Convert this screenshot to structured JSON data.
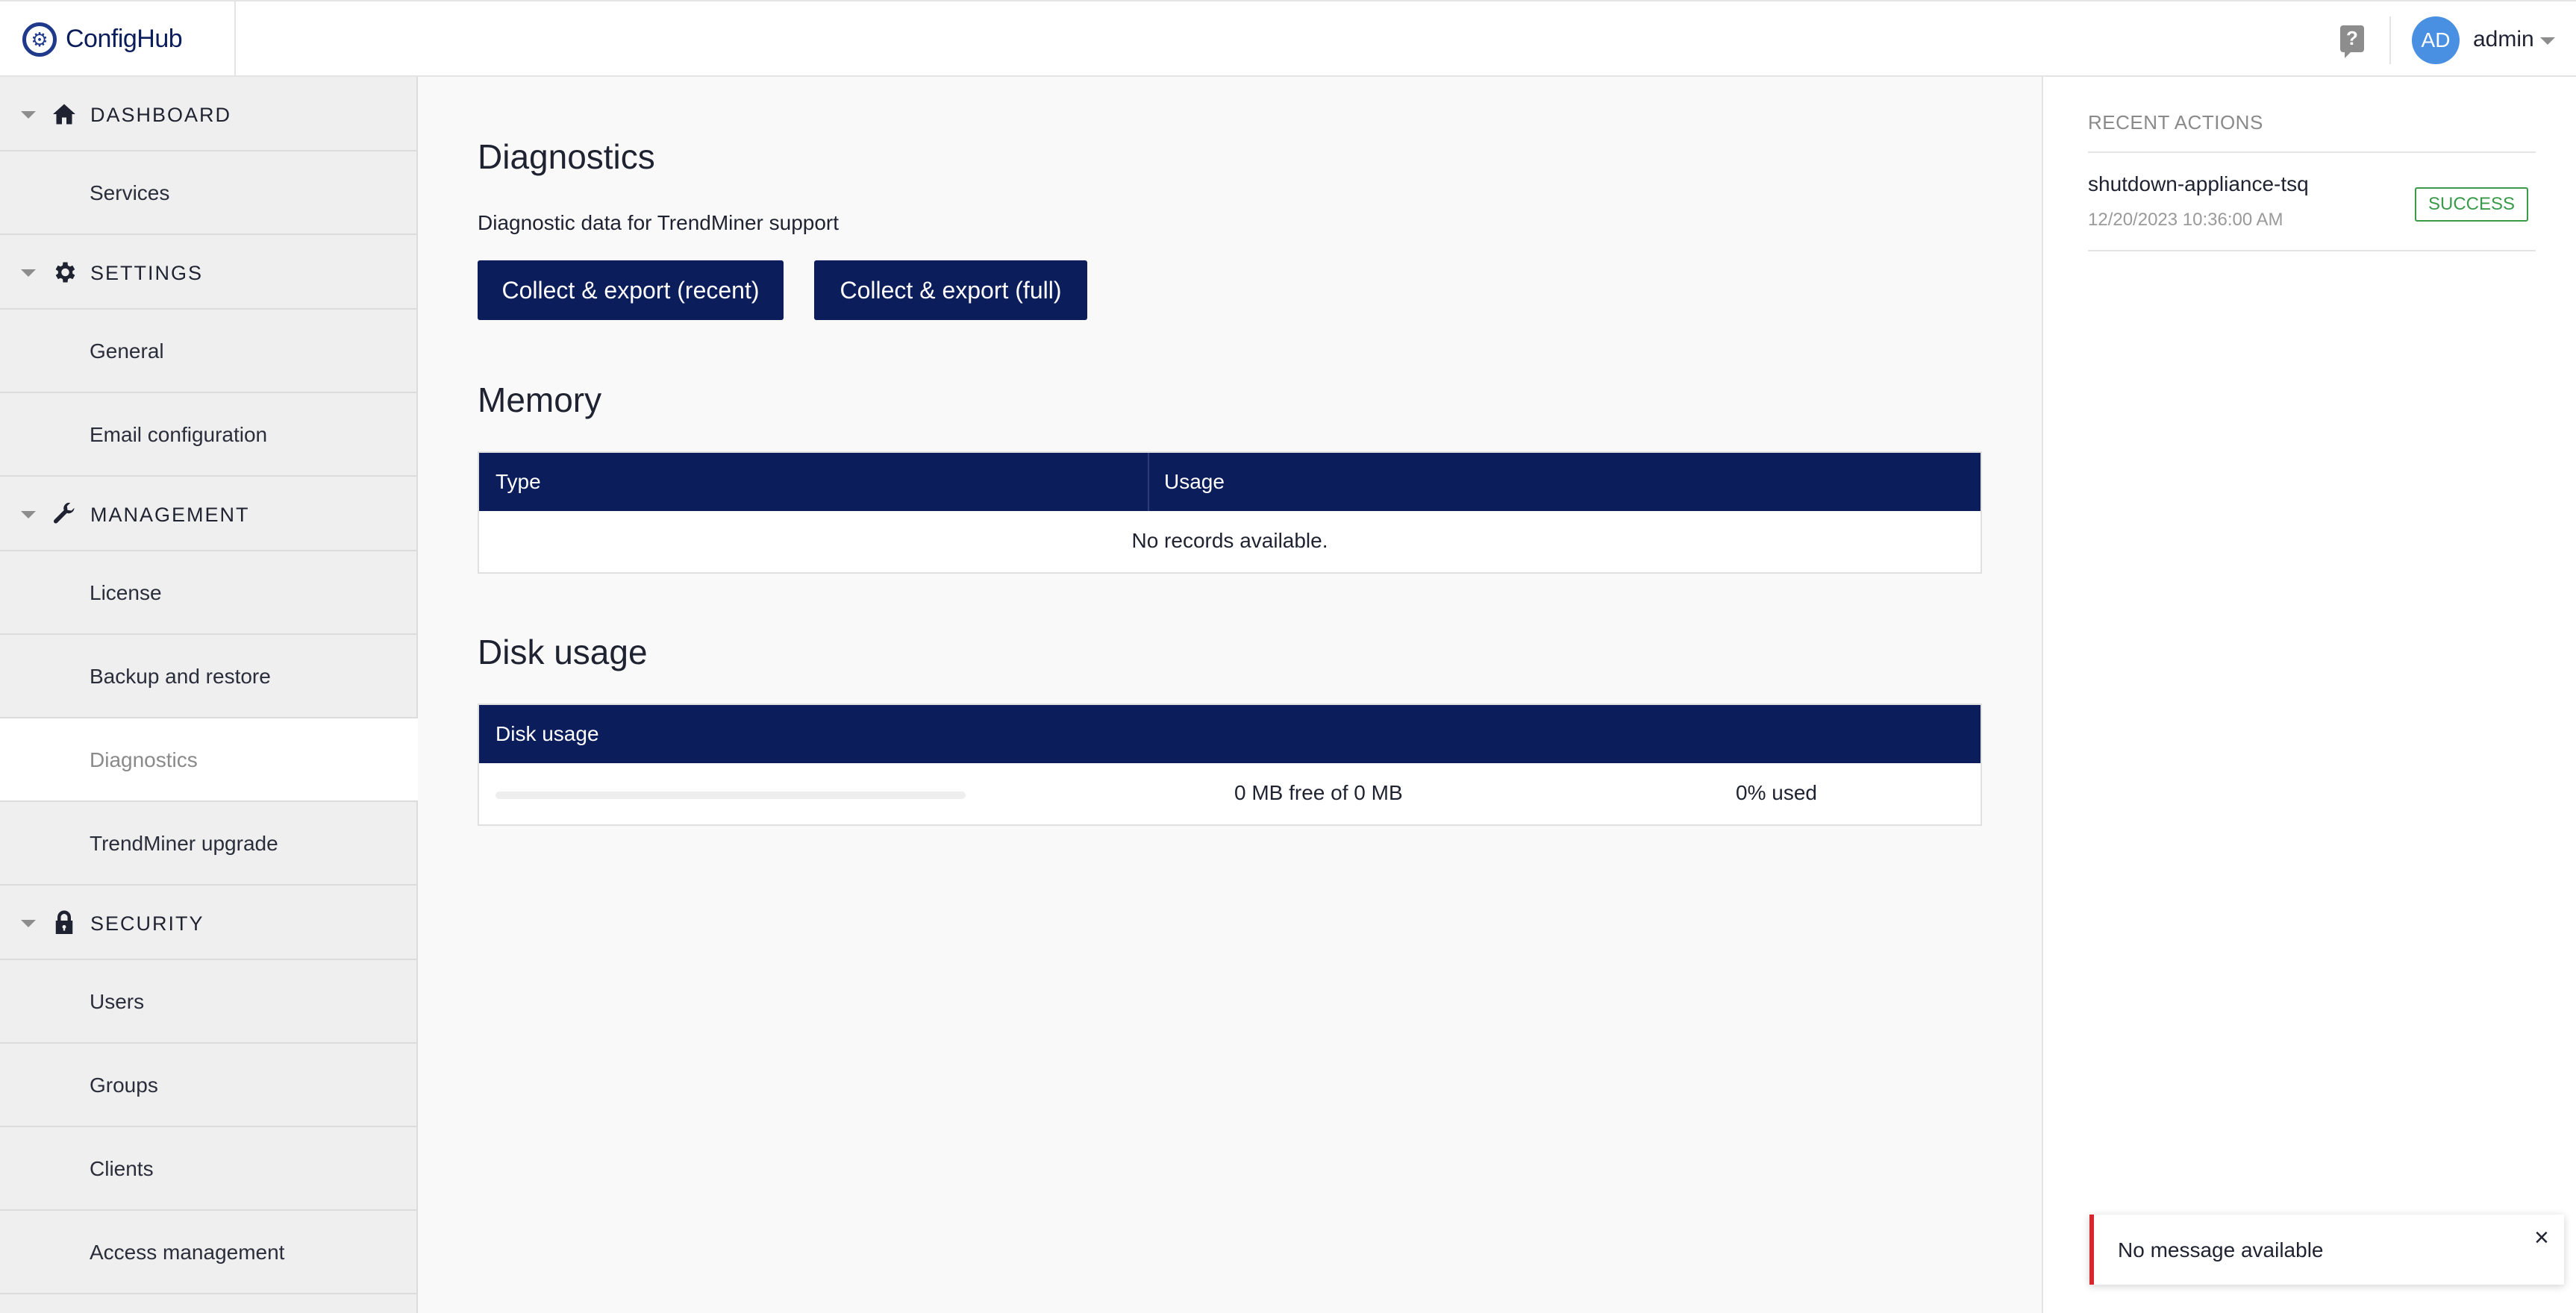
{
  "header": {
    "app_name": "ConfigHub",
    "help_icon": "question-mark-icon",
    "user_initials": "AD",
    "user_name": "admin"
  },
  "sidebar": {
    "sections": [
      {
        "label": "DASHBOARD",
        "icon": "home-icon",
        "items": [
          "Services"
        ]
      },
      {
        "label": "SETTINGS",
        "icon": "gear-icon",
        "items": [
          "General",
          "Email configuration"
        ]
      },
      {
        "label": "MANAGEMENT",
        "icon": "wrench-icon",
        "items": [
          "License",
          "Backup and restore",
          "Diagnostics",
          "TrendMiner upgrade"
        ]
      },
      {
        "label": "SECURITY",
        "icon": "lock-icon",
        "items": [
          "Users",
          "Groups",
          "Clients",
          "Access management"
        ]
      }
    ],
    "active_item": "Diagnostics"
  },
  "main": {
    "diagnostics": {
      "title": "Diagnostics",
      "description": "Diagnostic data for TrendMiner support",
      "button_recent": "Collect & export (recent)",
      "button_full": "Collect & export (full)"
    },
    "memory": {
      "title": "Memory",
      "columns": [
        "Type",
        "Usage"
      ],
      "empty_text": "No records available."
    },
    "disk": {
      "title": "Disk usage",
      "column": "Disk usage",
      "free_text": "0 MB free of 0 MB",
      "used_text": "0% used",
      "used_percent": 0
    }
  },
  "recent_actions": {
    "title": "RECENT ACTIONS",
    "items": [
      {
        "name": "shutdown-appliance-tsq",
        "time": "12/20/2023 10:36:00 AM",
        "status": "SUCCESS"
      }
    ]
  },
  "toast": {
    "message": "No message available",
    "close_icon": "close-icon",
    "accent_color": "#d9262c"
  },
  "colors": {
    "primary": "#0b1d5a",
    "success": "#3a9a4a",
    "avatar": "#4a90e2"
  }
}
